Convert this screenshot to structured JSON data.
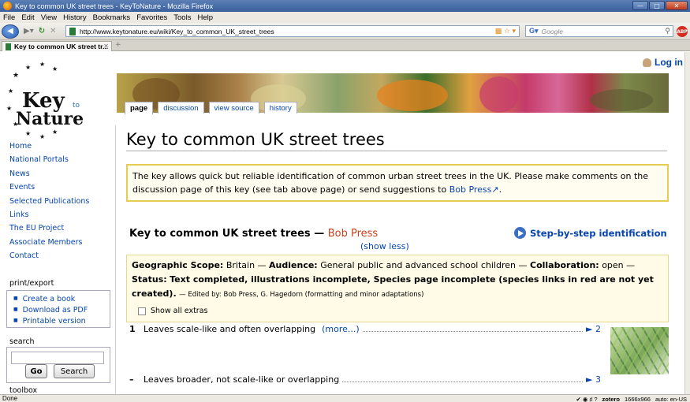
{
  "browser": {
    "window_title": "Key to common UK street trees - KeyToNature - Mozilla Firefox",
    "menu": [
      "File",
      "Edit",
      "View",
      "History",
      "Bookmarks",
      "Favorites",
      "Tools",
      "Help"
    ],
    "url": "http://www.keytonature.eu/wiki/Key_to_common_UK_street_trees",
    "search_placeholder": "Google",
    "tab_title": "Key to common UK street tr...",
    "status_text": "Done",
    "status_right": {
      "zotero": "zotero",
      "resolution": "1666x966",
      "locale": "auto: en-US"
    }
  },
  "page": {
    "login": "Log in",
    "logo_text": [
      "Key",
      "to",
      "Nature"
    ],
    "page_tabs": [
      "page",
      "discussion",
      "view source",
      "history"
    ],
    "sidebar": [
      "Home",
      "National Portals",
      "News",
      "Events",
      "Selected Publications",
      "Links",
      "The EU Project",
      "Associate Members",
      "Contact"
    ],
    "print_export": {
      "title": "print/export",
      "items": [
        "Create a book",
        "Download as PDF",
        "Printable version"
      ]
    },
    "search": {
      "title": "search",
      "go": "Go",
      "search": "Search"
    },
    "toolbox_title": "toolbox",
    "title": "Key to common UK street trees",
    "intro": "The key allows quick but reliable identification of common urban street trees in the UK. Please make comments on the discussion page of this key (see tab above page) or send suggestions to",
    "intro_link": "Bob Press",
    "key_title": "Key to common UK street trees",
    "key_dash": " — ",
    "key_author": "Bob Press",
    "show_less": "(show less)",
    "step_by_step": "Step-by-step identification",
    "meta": {
      "scope_label": "Geographic Scope:",
      "scope": "Britain",
      "audience_label": "Audience:",
      "audience": "General public and advanced school children",
      "collab_label": "Collaboration:",
      "collab": "open",
      "status_label": "Status:",
      "status": "Text completed, illustrations incomplete, Species page incomplete (species links in red are not yet created).",
      "edited": "— Edited by: Bob Press, G. Hagedorn (formatting and minor adaptations)",
      "show_extras": "Show all extras"
    },
    "leads": [
      {
        "num": "1",
        "text": "Leaves scale-like and often overlapping",
        "more": "(more...)",
        "target": "► 2"
      },
      {
        "num": "–",
        "text": "Leaves broader, not scale-like or overlapping",
        "more": "",
        "target": "► 3"
      }
    ]
  }
}
